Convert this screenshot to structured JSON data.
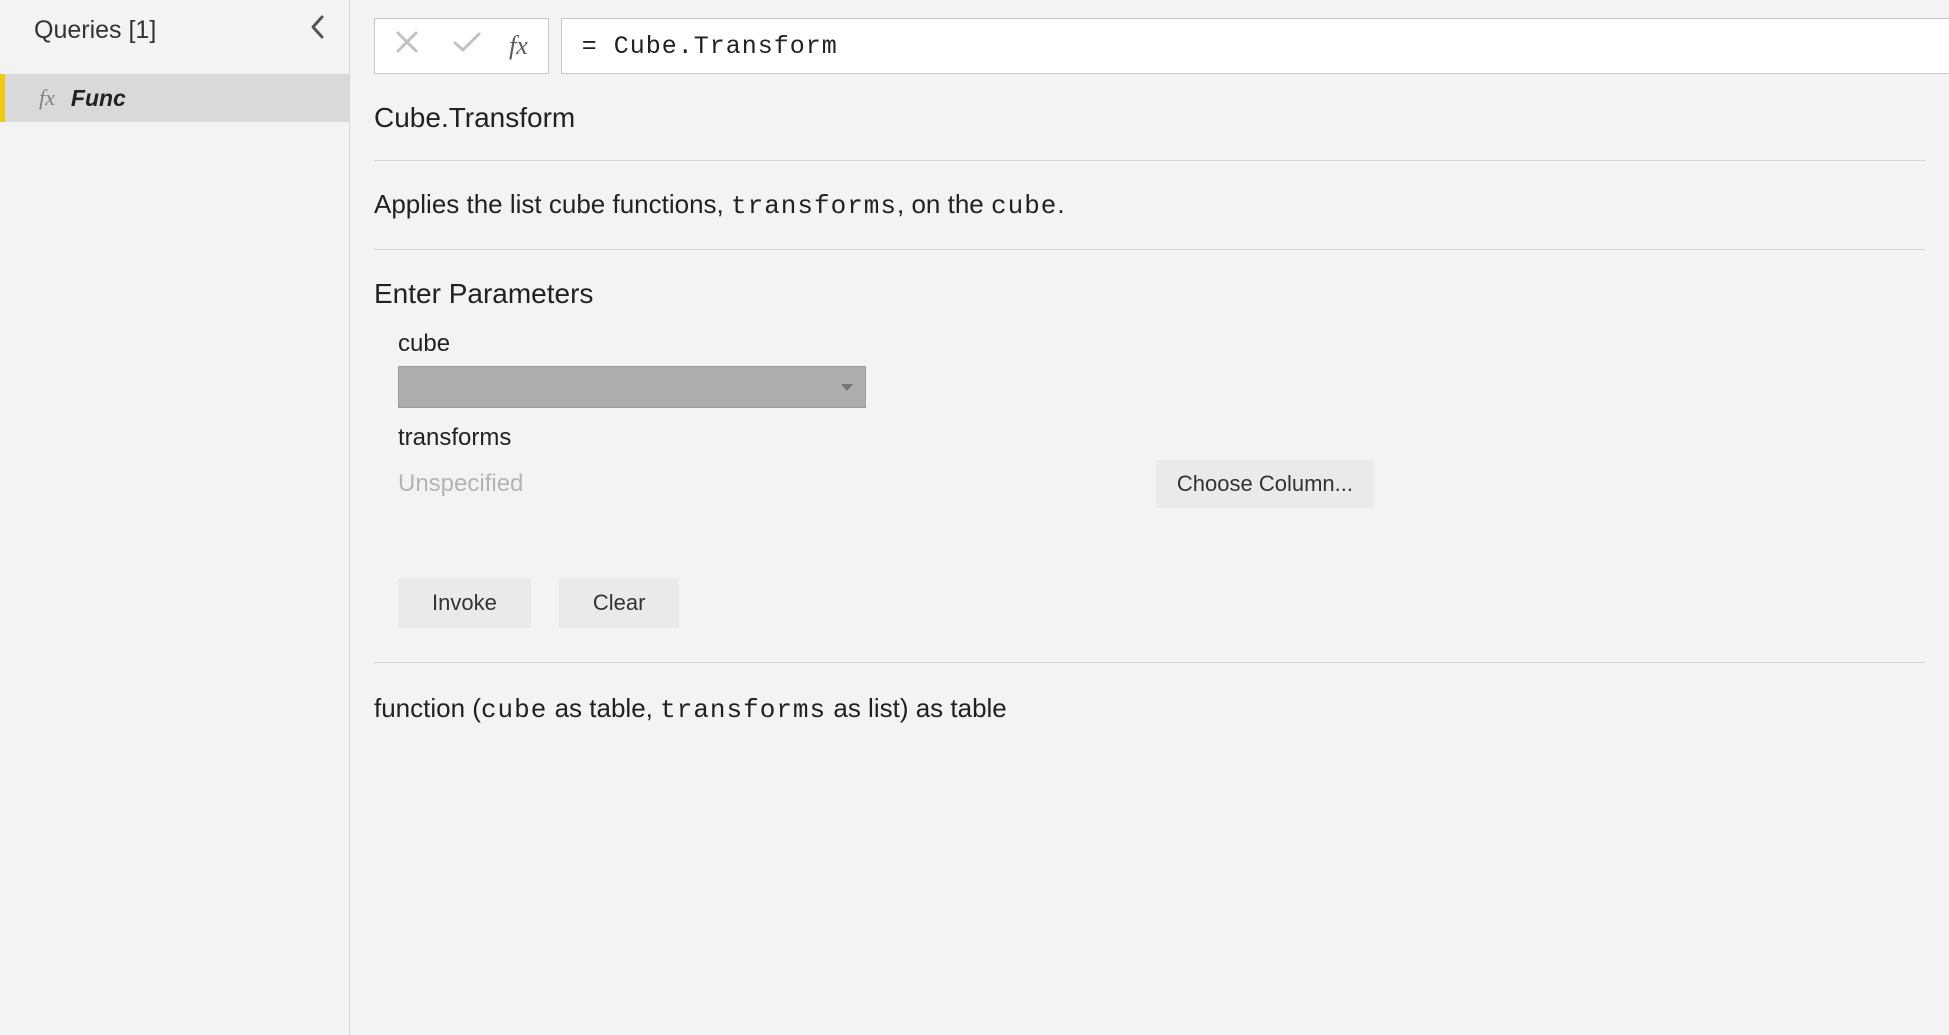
{
  "sidebar": {
    "title": "Queries [1]",
    "items": [
      {
        "icon": "fx",
        "name": "Func"
      }
    ]
  },
  "formula_bar": {
    "cancel_icon": "✕",
    "confirm_icon": "✓",
    "fx_label": "fx",
    "formula": "= Cube.Transform"
  },
  "function": {
    "name": "Cube.Transform",
    "description_prefix": "Applies the list cube functions, ",
    "description_param1": "transforms",
    "description_mid": ", on the ",
    "description_param2": "cube",
    "description_suffix": "."
  },
  "parameters": {
    "section_title": "Enter Parameters",
    "items": [
      {
        "label": "cube",
        "type": "dropdown"
      },
      {
        "label": "transforms",
        "type": "column",
        "status": "Unspecified",
        "choose_label": "Choose Column..."
      }
    ]
  },
  "actions": {
    "invoke": "Invoke",
    "clear": "Clear"
  },
  "signature": {
    "prefix": "function (",
    "p1": "cube",
    "t1": " as table, ",
    "p2": "transforms",
    "t2": " as list) as table"
  }
}
